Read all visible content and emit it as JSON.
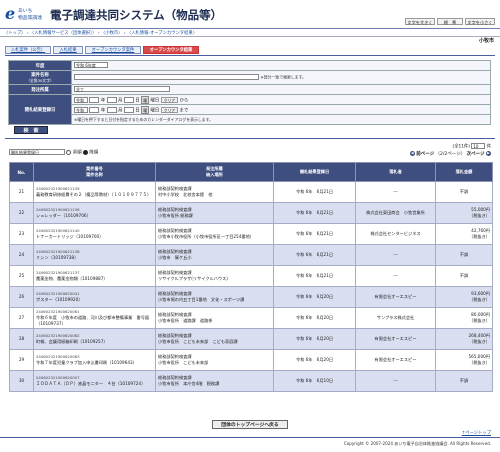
{
  "header": {
    "logo_mark": "e",
    "logo_line1": "あいち",
    "logo_line2": "物品等調達",
    "title": "電子調達共同システム（物品等）",
    "font_buttons": [
      "文字を大きく",
      "標　準",
      "文字を小さく"
    ]
  },
  "breadcrumb": "〈トップ〉 › 〈入札情報サービス（団体選択）〉 › 〈小牧市〉 › 〈入札情報-オープンカウンタ結果〉",
  "city": "小牧市",
  "tabs": [
    "入札案件（公告）",
    "入札結果",
    "オープンカウンタ案件",
    "オープンカウンタ結果"
  ],
  "form": {
    "year_label": "年度",
    "year_value": "令和 6年度",
    "case_label": "案件名称",
    "case_sub": "（全角30文字）",
    "case_note": "※部分一致で検索します。",
    "dept_label": "発注所属",
    "dept_value": "全て",
    "date_label": "開札結果登録日",
    "era": "令和",
    "y_unit": "年",
    "m_unit": "月",
    "d_unit": "日",
    "cal_icon": "曜",
    "weekday": "曜日",
    "clear": "クリア",
    "from": "から",
    "to": "まで",
    "date_note": "※曜日を押下すると日付を指定するためのカレンダーダイアログを表示します。",
    "search_button": "検　索"
  },
  "sort": {
    "field": "開札結果登録日",
    "asc": "昇順",
    "desc": "降順"
  },
  "count": {
    "label": "(全11件)",
    "per_page": "10",
    "unit": "件"
  },
  "pager": {
    "prev": "前ページ",
    "page": "（2/2ページ）",
    "next": "次ページ"
  },
  "table": {
    "headers": [
      "No.",
      "案件番号\n案件名称",
      "発注所属\n納入場所",
      "開札結果登録日",
      "落札者",
      "落札金額"
    ],
    "rows": [
      {
        "no": "21",
        "id": "240602321900621139",
        "name": "義務教育研修経費その２（備品等教材）（１０１０９７７５）",
        "dept": "総務部契約検査課",
        "place": "村中小学校　北校舎本館　他",
        "date": "令和 6年　6月21日",
        "winner": "---",
        "amount": "不調",
        "amount_note": ""
      },
      {
        "no": "22",
        "id": "240602321900621136",
        "name": "シュレッダー（10109706）",
        "dept": "総務部契約検査課",
        "place": "小牧市役所 総務課",
        "date": "令和 6年　6月21日",
        "winner": "株式会社東田商会　小牧営業所",
        "amount": "55,000円",
        "amount_note": "（税抜き）"
      },
      {
        "no": "23",
        "id": "240602321900621140",
        "name": "トナーカートリッジ（10109700）",
        "dept": "総務部契約検査課",
        "place": "小牧市小牧市役所（小牧市役所区一丁目254番地）",
        "date": "令和 6年　6月21日",
        "winner": "株式会社センタービジネス",
        "amount": "42,760円",
        "amount_note": "（税抜き）"
      },
      {
        "no": "24",
        "id": "240602321900621138",
        "name": "ミシン（10109738）",
        "dept": "総務部契約検査課",
        "place": "小牧市　篠ケ丘小",
        "date": "令和 6年　6月21日",
        "winner": "---",
        "amount": "不調",
        "amount_note": ""
      },
      {
        "no": "25",
        "id": "240602321900621137",
        "name": "農薬金物、農薬金物類（10109887）",
        "dept": "総務部契約検査課",
        "place": "リサイクルプラザ(リサイクルハウス)",
        "date": "令和 6年　6月21日",
        "winner": "---",
        "amount": "不調",
        "amount_note": ""
      },
      {
        "no": "26",
        "id": "240602321900620041",
        "name": "ポスター（10109920）",
        "dept": "総務部契約検査課",
        "place": "小牧市堀の内五丁目1番地　文化・スポーツ課",
        "date": "令和 6年　6月20日",
        "winner": "有限会社オーエスピー",
        "amount": "93,600円",
        "amount_note": "（税抜き）"
      },
      {
        "no": "27",
        "id": "240602321900620061",
        "name": "令和６年度　小牧市の道路、河川及び都市整備事業　番号図（10109737）",
        "dept": "総務部契約検査課",
        "place": "小牧市役所　道路課　道路係",
        "date": "令和 6年　6月20日",
        "winner": "サンプラス株式会社",
        "amount": "80,000円",
        "amount_note": "（税抜き）"
      },
      {
        "no": "28",
        "id": "240602321900620062",
        "name": "町報、会議用紙箱印刷（10109257）",
        "dept": "総務部契約検査課",
        "place": "小牧市役所　こども未来部　こども家庭課",
        "date": "令和 6年　6月20日",
        "winner": "有限会社オーエスピー",
        "amount": "268,400円",
        "amount_note": "（税抜き）"
      },
      {
        "no": "29",
        "id": "240602321900620063",
        "name": "令和７年度児童クラブ加入申込書印刷（10109643）",
        "dept": "総務部契約検査課",
        "place": "小牧市役所　こども未来部",
        "date": "令和 6年　6月20日",
        "winner": "有限会社オーエスピー",
        "amount": "565,000円",
        "amount_note": "（税抜き）"
      },
      {
        "no": "30",
        "id": "240602321900620007",
        "name": "ＩＯＤＡＴＡ（ＤＰ）液晶モニター　４台（10109724）",
        "dept": "総務部契約検査課",
        "place": "小牧市役所　本庁舎4階　税務課",
        "date": "令和 6年　6月10日",
        "winner": "---",
        "amount": "不調",
        "amount_note": ""
      }
    ]
  },
  "bottom_button": "団体のトップページへ戻る",
  "page_top": "↑ページトップ",
  "copyright": "Copyright © 2007-2024 あいち電子自治体推進協議会. All Rights Reserved."
}
